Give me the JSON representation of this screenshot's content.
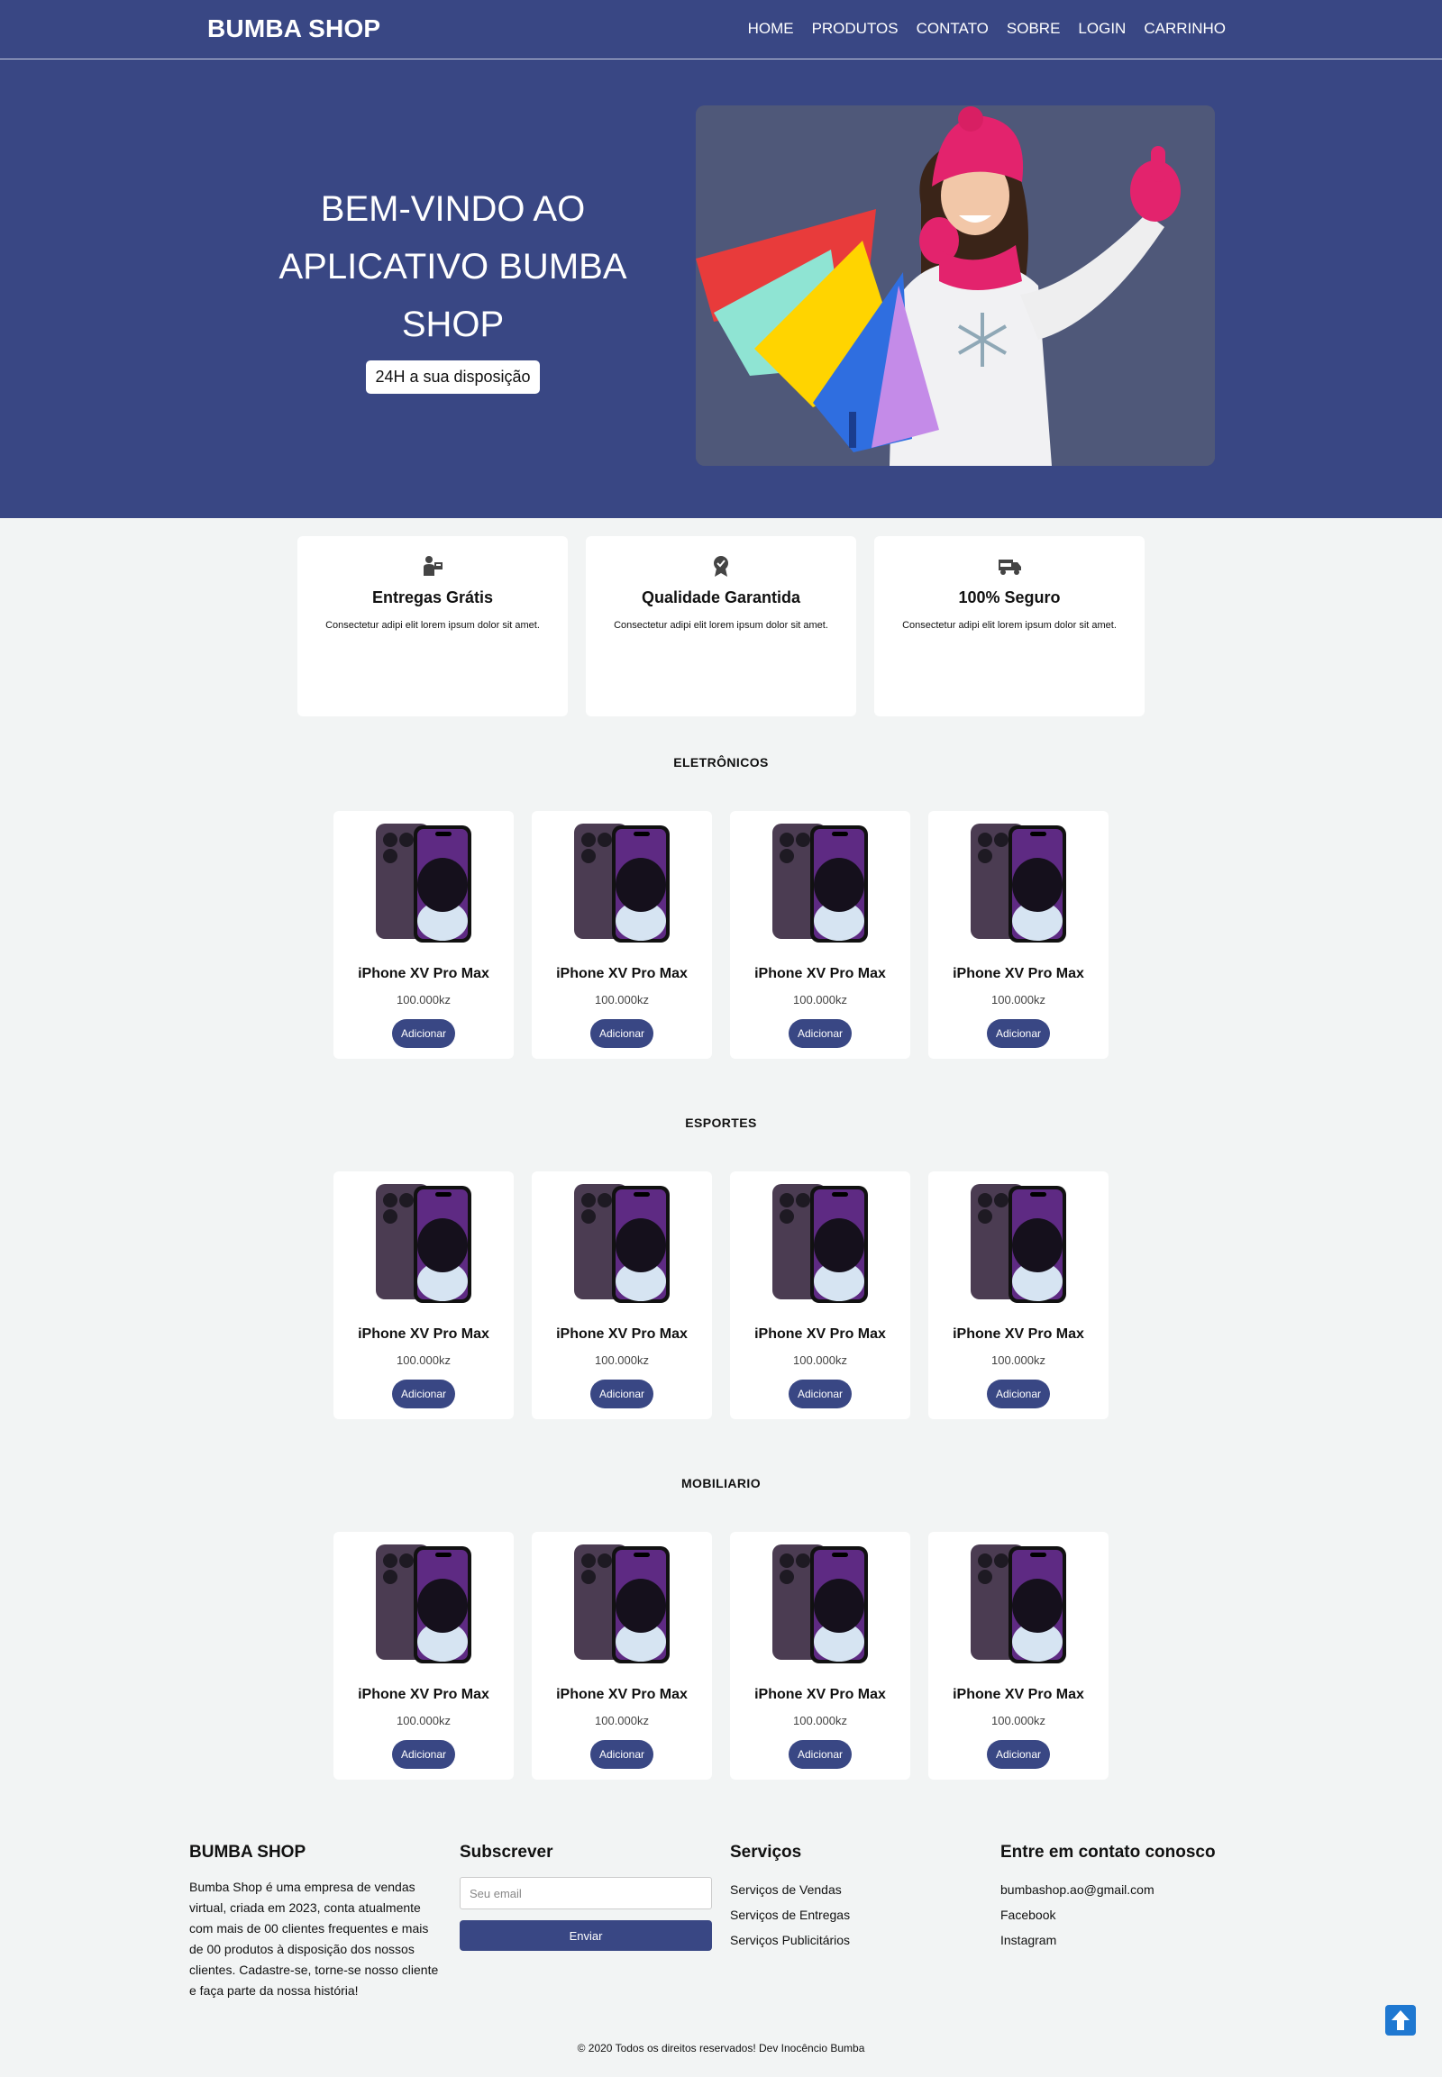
{
  "brand": "BUMBA SHOP",
  "nav": [
    "HOME",
    "PRODUTOS",
    "CONTATO",
    "SOBRE",
    "LOGIN",
    "CARRINHO"
  ],
  "hero": {
    "title_lines": [
      "BEM-VINDO AO",
      "APLICATIVO BUMBA",
      "SHOP"
    ],
    "badge": "24H a sua disposição",
    "image_icon": "girl-with-shopping-bags-image"
  },
  "features": [
    {
      "icon": "delivery-person-icon",
      "title": "Entregas Grátis",
      "text": "Consectetur adipi elit lorem ipsum dolor sit amet."
    },
    {
      "icon": "quality-badge-icon",
      "title": "Qualidade Garantida",
      "text": "Consectetur adipi elit lorem ipsum dolor sit amet."
    },
    {
      "icon": "free-truck-icon",
      "title": "100% Seguro",
      "text": "Consectetur adipi elit lorem ipsum dolor sit amet."
    }
  ],
  "sections": [
    {
      "title": "ELETRÔNICOS",
      "products": [
        {
          "name": "iPhone XV Pro Max",
          "price": "100.000kz",
          "button": "Adicionar"
        },
        {
          "name": "iPhone XV Pro Max",
          "price": "100.000kz",
          "button": "Adicionar"
        },
        {
          "name": "iPhone XV Pro Max",
          "price": "100.000kz",
          "button": "Adicionar"
        },
        {
          "name": "iPhone XV Pro Max",
          "price": "100.000kz",
          "button": "Adicionar"
        }
      ]
    },
    {
      "title": "ESPORTES",
      "products": [
        {
          "name": "iPhone XV Pro Max",
          "price": "100.000kz",
          "button": "Adicionar"
        },
        {
          "name": "iPhone XV Pro Max",
          "price": "100.000kz",
          "button": "Adicionar"
        },
        {
          "name": "iPhone XV Pro Max",
          "price": "100.000kz",
          "button": "Adicionar"
        },
        {
          "name": "iPhone XV Pro Max",
          "price": "100.000kz",
          "button": "Adicionar"
        }
      ]
    },
    {
      "title": "MOBILIARIO",
      "products": [
        {
          "name": "iPhone XV Pro Max",
          "price": "100.000kz",
          "button": "Adicionar"
        },
        {
          "name": "iPhone XV Pro Max",
          "price": "100.000kz",
          "button": "Adicionar"
        },
        {
          "name": "iPhone XV Pro Max",
          "price": "100.000kz",
          "button": "Adicionar"
        },
        {
          "name": "iPhone XV Pro Max",
          "price": "100.000kz",
          "button": "Adicionar"
        }
      ]
    }
  ],
  "footer": {
    "about": {
      "title": "BUMBA SHOP",
      "text": "Bumba Shop é uma empresa de vendas virtual, criada em 2023, conta atualmente com mais de 00 clientes frequentes e mais de 00 produtos à disposição dos nossos clientes. Cadastre-se, torne-se nosso cliente e faça parte da nossa história!"
    },
    "subscribe": {
      "title": "Subscrever",
      "placeholder": "Seu email",
      "button": "Enviar"
    },
    "services": {
      "title": "Serviços",
      "items": [
        "Serviços de Vendas",
        "Serviços de Entregas",
        "Serviços Publicitários"
      ]
    },
    "contact": {
      "title": "Entre em contato conosco",
      "items": [
        "bumbashop.ao@gmail.com",
        "Facebook",
        "Instagram"
      ]
    },
    "copyright": "© 2020 Todos os direitos reservados! Dev Inocêncio Bumba"
  },
  "colors": {
    "primary": "#394784",
    "background": "#f2f4f4",
    "scroll_top": "#1f78d1"
  },
  "scroll_top_icon": "arrow-up-icon"
}
